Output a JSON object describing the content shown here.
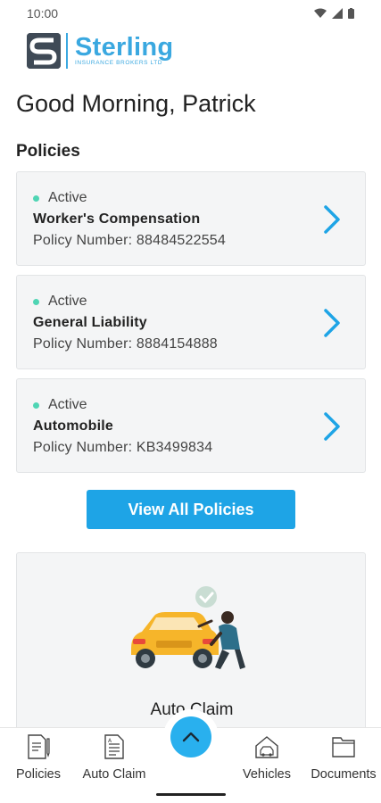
{
  "status_bar": {
    "time": "10:00"
  },
  "brand": {
    "name": "Sterling",
    "subtitle": "INSURANCE BROKERS LTD",
    "accent_color": "#3aa8e0"
  },
  "greeting": "Good Morning, Patrick",
  "policies_section": {
    "title": "Policies",
    "items": [
      {
        "status": "Active",
        "name": "Worker's Compensation",
        "number": "Policy Number: 88484522554"
      },
      {
        "status": "Active",
        "name": "General Liability",
        "number": "Policy Number: 8884154888"
      },
      {
        "status": "Active",
        "name": "Automobile",
        "number": "Policy Number: KB3499834"
      }
    ],
    "view_all_label": "View All Policies"
  },
  "claim_card": {
    "title": "Auto Claim",
    "illustration": "car-mechanic-illustration"
  },
  "bottom_nav": {
    "items": [
      {
        "label": "Policies",
        "icon": "policy-doc-icon"
      },
      {
        "label": "Auto Claim",
        "icon": "claim-doc-icon"
      },
      {
        "label": "Vehicles",
        "icon": "vehicle-icon"
      },
      {
        "label": "Documents",
        "icon": "folder-icon"
      }
    ],
    "fab_icon": "chevron-up-icon"
  },
  "colors": {
    "primary": "#1ea4e6",
    "status_active": "#4fd5b4",
    "card_bg": "#f4f5f6"
  }
}
